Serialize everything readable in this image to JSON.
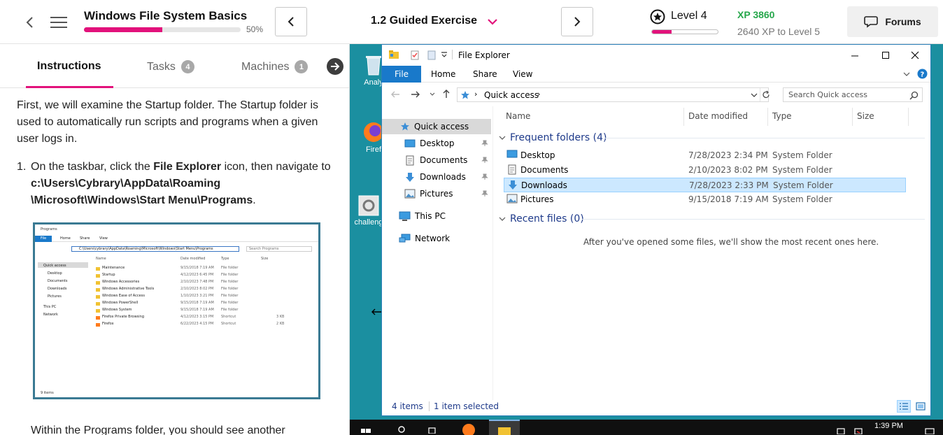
{
  "header": {
    "course_title": "Windows File System Basics",
    "progress_percent": 50,
    "progress_text": "50%",
    "exercise_title": "1.2 Guided Exercise",
    "level_text": "Level 4",
    "level_progress_fraction": 0.3,
    "xp_text": "XP 3860",
    "xp_next_text": "2640 XP to Level 5",
    "forums_label": "Forums",
    "accent_color": "#e2127b",
    "xp_color": "#26a74b"
  },
  "tabs": [
    {
      "label": "Instructions",
      "active": true
    },
    {
      "label": "Tasks",
      "count": "4"
    },
    {
      "label": "Machines",
      "count": "1"
    }
  ],
  "instructions": {
    "intro": "First, we will examine the Startup folder. The Startup folder is used to automatically run scripts and programs when a given user logs in.",
    "step_number": "1.",
    "step_text_1": "On the taskbar, click the ",
    "step_bold_1": "File Explorer",
    "step_text_2": " icon, then navigate to ",
    "step_bold_2": "c:\\Users\\Cybrary\\AppData\\Roaming \\Microsoft\\Windows\\Start Menu\\Programs",
    "step_text_3": ".",
    "bottom_text": "Within the Programs folder, you should see another"
  },
  "screenshot_thumb": {
    "title": "Programs",
    "ribbon": [
      "File",
      "Home",
      "Share",
      "View"
    ],
    "address": "C:\\Users\\cybrary\\AppData\\Roaming\\Microsoft\\Windows\\Start Menu\\Programs",
    "search": "Search Programs",
    "nav": [
      "Quick access",
      "Desktop",
      "Documents",
      "Downloads",
      "Pictures",
      "This PC",
      "Network"
    ],
    "columns": [
      "Name",
      "Date modified",
      "Type",
      "Size"
    ],
    "rows": [
      {
        "name": "Maintenance",
        "date": "9/15/2018 7:19 AM",
        "type": "File folder",
        "size": ""
      },
      {
        "name": "Startup",
        "date": "4/12/2023 6:45 PM",
        "type": "File folder",
        "size": ""
      },
      {
        "name": "Windows Accessories",
        "date": "2/10/2023 7:48 PM",
        "type": "File folder",
        "size": ""
      },
      {
        "name": "Windows Administrative Tools",
        "date": "2/10/2023 8:02 PM",
        "type": "File folder",
        "size": ""
      },
      {
        "name": "Windows Ease of Access",
        "date": "1/10/2023 3:21 PM",
        "type": "File folder",
        "size": ""
      },
      {
        "name": "Windows PowerShell",
        "date": "9/15/2018 7:19 AM",
        "type": "File folder",
        "size": ""
      },
      {
        "name": "Windows System",
        "date": "9/15/2018 7:19 AM",
        "type": "File folder",
        "size": ""
      },
      {
        "name": "Firefox Private Browsing",
        "date": "4/12/2023 3:15 PM",
        "type": "Shortcut",
        "size": "3 KB"
      },
      {
        "name": "Firefox",
        "date": "6/22/2023 4:15 PM",
        "type": "Shortcut",
        "size": "2 KB"
      }
    ],
    "status": "9 items"
  },
  "desktop": {
    "icons": [
      "Analy",
      "Firef",
      "challeng"
    ],
    "clock": "1:39 PM"
  },
  "explorer": {
    "title": "File Explorer",
    "ribbon_tabs": [
      "File",
      "Home",
      "Share",
      "View"
    ],
    "breadcrumb": "Quick access",
    "search_placeholder": "Search Quick access",
    "nav": {
      "quick_access": "Quick access",
      "desktop": "Desktop",
      "documents": "Documents",
      "downloads": "Downloads",
      "pictures": "Pictures",
      "this_pc": "This PC",
      "network": "Network"
    },
    "columns": {
      "name": "Name",
      "date": "Date modified",
      "type": "Type",
      "size": "Size"
    },
    "frequent_header": "Frequent folders (4)",
    "recent_header": "Recent files (0)",
    "recent_empty": "After you've opened some files, we'll show the most recent ones here.",
    "rows": [
      {
        "name": "Desktop",
        "date": "7/28/2023 2:34 PM",
        "type": "System Folder"
      },
      {
        "name": "Documents",
        "date": "2/10/2023 8:02 PM",
        "type": "System Folder"
      },
      {
        "name": "Downloads",
        "date": "7/28/2023 2:33 PM",
        "type": "System Folder"
      },
      {
        "name": "Pictures",
        "date": "9/15/2018 7:19 AM",
        "type": "System Folder"
      }
    ],
    "status_items": "4 items",
    "status_selected": "1 item selected",
    "accent_color": "#1979ca"
  }
}
